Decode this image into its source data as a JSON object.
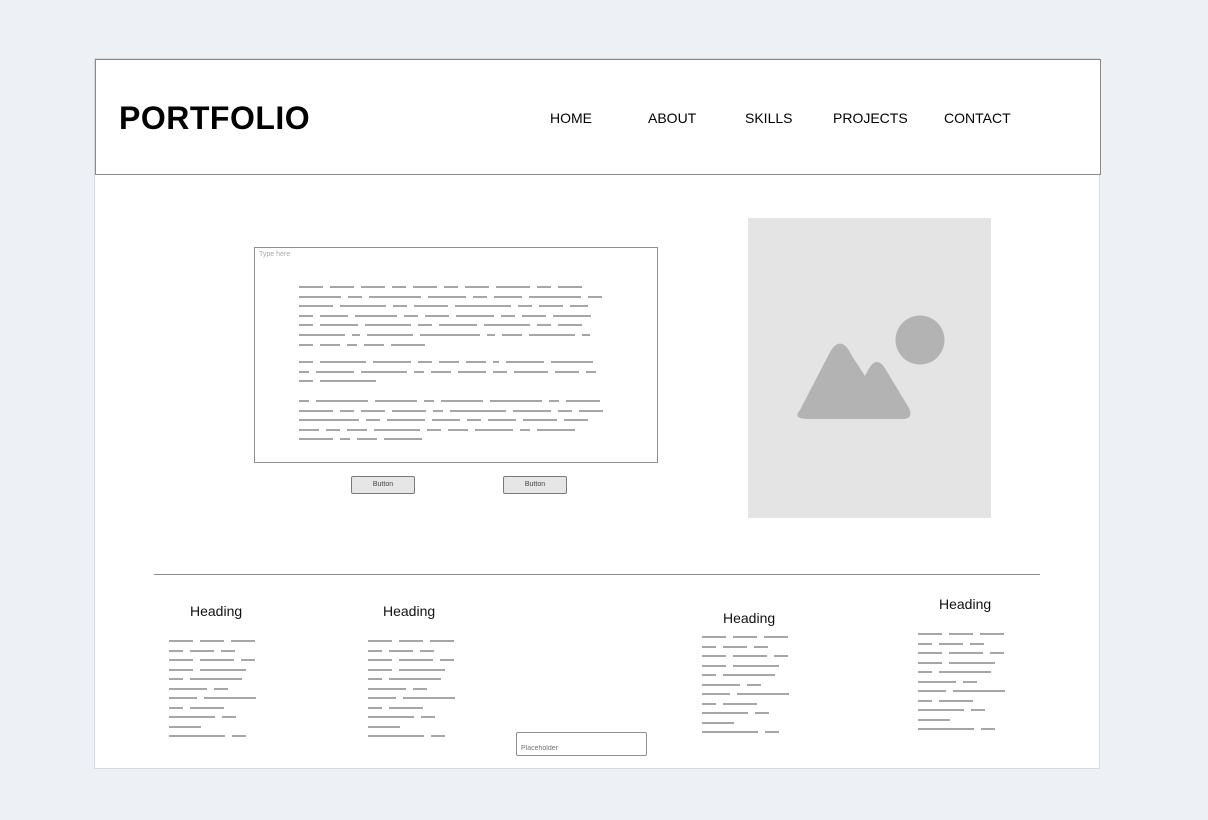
{
  "header": {
    "logo": "PORTFOLIO",
    "nav": [
      {
        "label": "HOME"
      },
      {
        "label": "ABOUT"
      },
      {
        "label": "SKILLS"
      },
      {
        "label": "PROJECTS"
      },
      {
        "label": "CONTACT"
      }
    ]
  },
  "hero": {
    "textarea_placeholder": "Type here",
    "buttons": [
      {
        "label": "Button"
      },
      {
        "label": "Button"
      }
    ],
    "image_icon": "image-placeholder-icon"
  },
  "columns": [
    {
      "heading": "Heading"
    },
    {
      "heading": "Heading"
    },
    {
      "heading": "Heading"
    },
    {
      "heading": "Heading"
    }
  ],
  "footer": {
    "input_placeholder": "Placeholder"
  },
  "colors": {
    "background": "#edf0f5",
    "placeholder_gray": "#e4e4e4",
    "icon_gray": "#b3b3b3",
    "text_line_gray": "#a6a6a6"
  }
}
